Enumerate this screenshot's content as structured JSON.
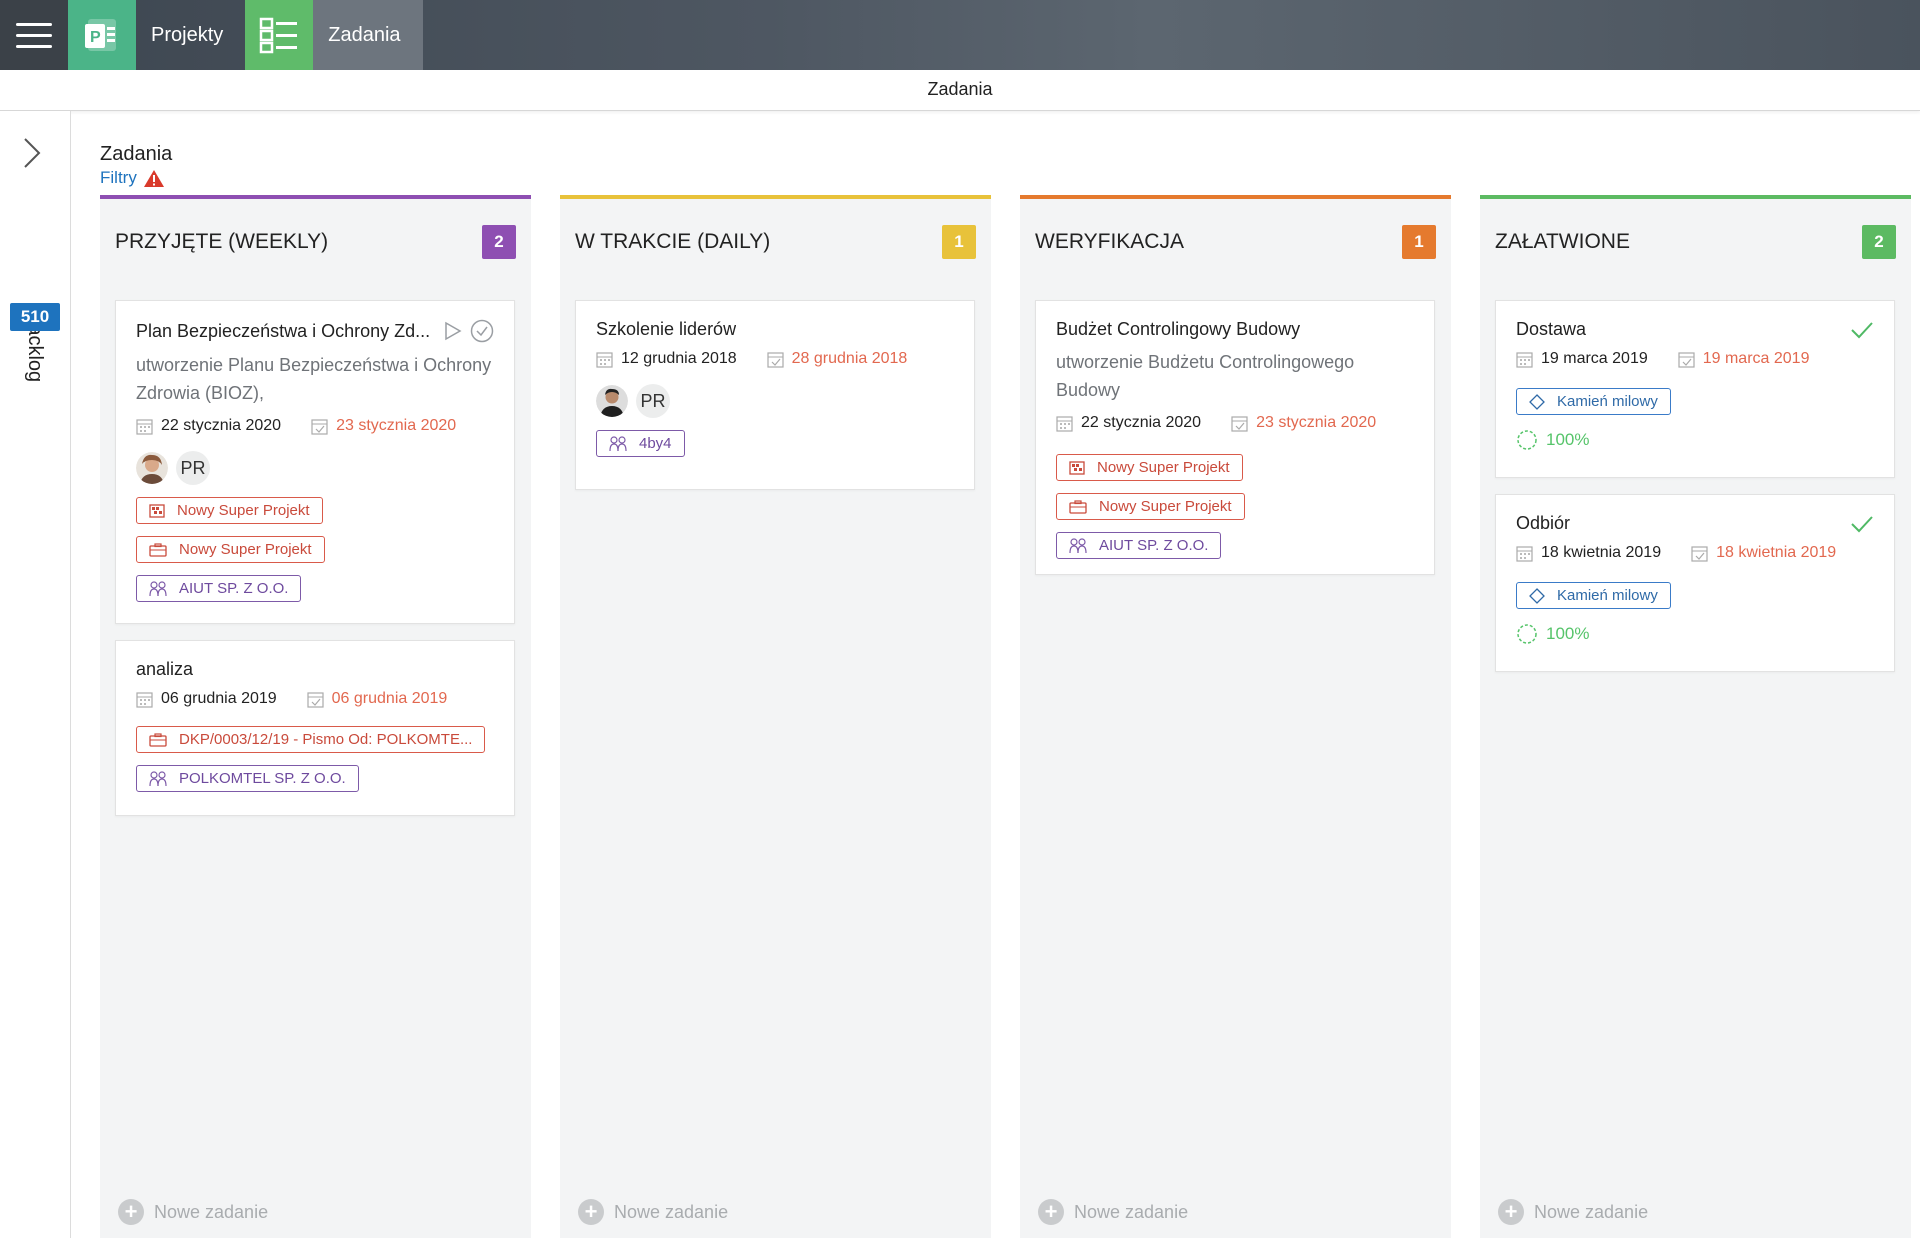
{
  "topbar": {
    "apps": [
      {
        "label": "Projekty"
      },
      {
        "label": "Zadania"
      }
    ]
  },
  "subheader": {
    "title": "Zadania"
  },
  "sidebar": {
    "label": "Backlog",
    "count": "510"
  },
  "page": {
    "title": "Zadania",
    "filters_label": "Filtry"
  },
  "new_task_label": "Nowe zadanie",
  "colors": {
    "purple": "#8e4fb2",
    "yellow": "#e8c23a",
    "orange": "#e57a2e",
    "green": "#5cba62",
    "date_overdue": "#e2684f",
    "link": "#1e73be"
  },
  "columns": [
    {
      "title": "PRZYJĘTE (WEEKLY)",
      "count": "2",
      "cards": [
        {
          "title": "Plan Bezpieczeństwa i Ochrony Zd...",
          "description": "utworzenie Planu Bezpieczeństwa i Ochrony Zdrowia (BIOZ),",
          "start_date": "22 stycznia 2020",
          "end_date": "23 stycznia 2020",
          "assignee": "PR",
          "tags": [
            {
              "icon": "project-icon",
              "label": "Nowy Super Projekt"
            },
            {
              "icon": "briefcase-icon",
              "label": "Nowy Super Projekt"
            },
            {
              "icon": "client-icon",
              "label": "AIUT SP. Z O.O."
            }
          ]
        },
        {
          "title": "analiza",
          "start_date": "06 grudnia 2019",
          "end_date": "06 grudnia 2019",
          "tags": [
            {
              "icon": "briefcase-icon",
              "label": "DKP/0003/12/19 - Pismo Od: POLKOMTE..."
            },
            {
              "icon": "client-icon",
              "label": "POLKOMTEL SP. Z O.O."
            }
          ]
        }
      ]
    },
    {
      "title": "W TRAKCIE (DAILY)",
      "count": "1",
      "cards": [
        {
          "title": "Szkolenie liderów",
          "start_date": "12 grudnia 2018",
          "end_date": "28 grudnia 2018",
          "assignee": "PR",
          "tags": [
            {
              "icon": "client-icon",
              "label": "4by4"
            }
          ]
        }
      ]
    },
    {
      "title": "WERYFIKACJA",
      "count": "1",
      "cards": [
        {
          "title": "Budżet Controlingowy Budowy",
          "description": "utworzenie Budżetu Controlingowego Budowy",
          "start_date": "22 stycznia 2020",
          "end_date": "23 stycznia 2020",
          "tags": [
            {
              "icon": "project-icon",
              "label": "Nowy Super Projekt"
            },
            {
              "icon": "briefcase-icon",
              "label": "Nowy Super Projekt"
            },
            {
              "icon": "client-icon",
              "label": "AIUT SP. Z O.O."
            }
          ]
        }
      ]
    },
    {
      "title": "ZAŁATWIONE",
      "count": "2",
      "cards": [
        {
          "title": "Dostawa",
          "start_date": "19 marca 2019",
          "end_date": "19 marca 2019",
          "milestone": "Kamień milowy",
          "progress": "100%"
        },
        {
          "title": "Odbiór",
          "start_date": "18 kwietnia 2019",
          "end_date": "18 kwietnia 2019",
          "milestone": "Kamień milowy",
          "progress": "100%"
        }
      ]
    }
  ]
}
